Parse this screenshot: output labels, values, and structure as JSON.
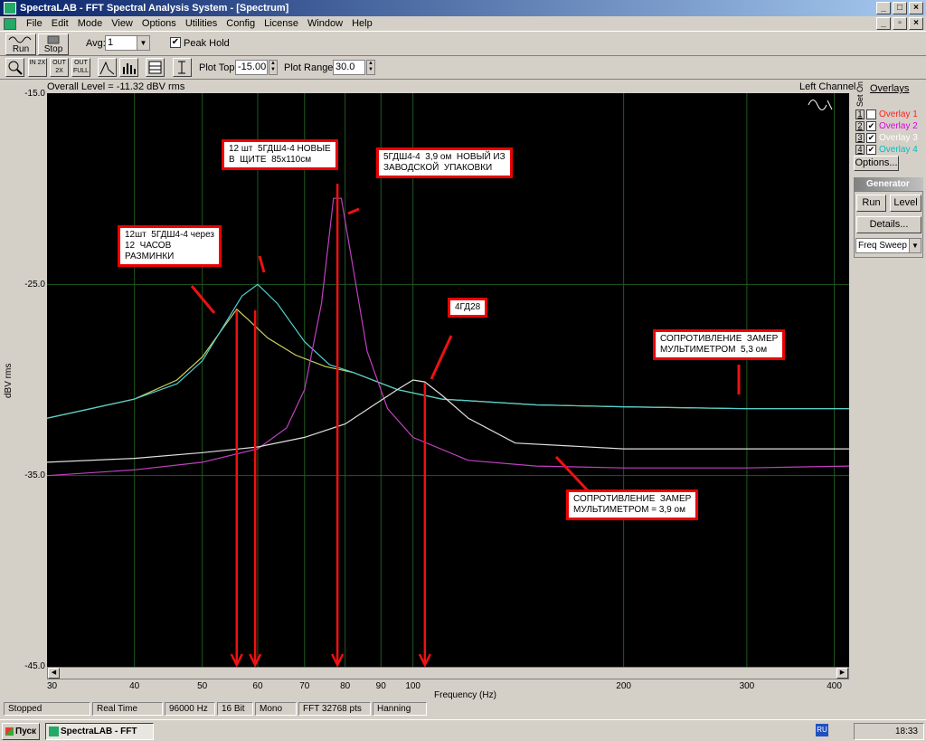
{
  "window": {
    "title": "SpectraLAB - FFT Spectral Analysis System - [Spectrum]"
  },
  "menu": [
    "File",
    "Edit",
    "Mode",
    "View",
    "Options",
    "Utilities",
    "Config",
    "License",
    "Window",
    "Help"
  ],
  "toolbar": {
    "run_label": "Run",
    "stop_label": "Stop",
    "avg_label": "Avg:",
    "avg_value": "1",
    "peak_hold_label": "Peak Hold",
    "peak_hold_checked": true,
    "plot_top_label": "Plot Top:",
    "plot_top_value": "-15.00",
    "plot_range_label": "Plot Range:",
    "plot_range_value": "30.0",
    "small_buttons": [
      "IN 2X",
      "OUT 2X",
      "OUT FULL"
    ]
  },
  "plot": {
    "overall_level": "Overall Level = -11.32 dBV rms",
    "channel": "Left Channel"
  },
  "chart_data": {
    "type": "line",
    "xlabel": "Frequency (Hz)",
    "ylabel": "dBV rms",
    "xscale": "log",
    "xlim": [
      30,
      420
    ],
    "ylim": [
      -45,
      -15
    ],
    "x_ticks": [
      "30",
      "40",
      "50",
      "60",
      "70",
      "80",
      "90",
      "100",
      "200",
      "300",
      "400"
    ],
    "y_ticks": [
      "-15.0",
      "-25.0",
      "-35.0",
      "-45.0"
    ],
    "grid": true,
    "series": [
      {
        "color": "#d0d060",
        "x": [
          30,
          40,
          46,
          50,
          53,
          56,
          58,
          62,
          68,
          75,
          82,
          95,
          110,
          150,
          200,
          300,
          420
        ],
        "y": [
          -32.0,
          -31.0,
          -30.0,
          -28.8,
          -27.5,
          -26.3,
          -26.8,
          -27.8,
          -28.7,
          -29.3,
          -29.6,
          -30.5,
          -31.0,
          -31.3,
          -31.4,
          -31.5,
          -31.5
        ]
      },
      {
        "color": "#50d0d0",
        "x": [
          30,
          40,
          46,
          50,
          54,
          57,
          60,
          64,
          70,
          76,
          82,
          95,
          110,
          150,
          200,
          300,
          420
        ],
        "y": [
          -32.0,
          -31.0,
          -30.2,
          -29.0,
          -27.0,
          -25.6,
          -25.0,
          -26.0,
          -28.0,
          -29.2,
          -29.6,
          -30.5,
          -31.0,
          -31.3,
          -31.4,
          -31.5,
          -31.5
        ]
      },
      {
        "color": "#c040c0",
        "x": [
          30,
          40,
          50,
          60,
          66,
          70,
          74,
          77,
          79,
          82,
          86,
          92,
          100,
          120,
          150,
          200,
          300,
          420
        ],
        "y": [
          -35.0,
          -34.7,
          -34.3,
          -33.6,
          -32.5,
          -30.5,
          -26.0,
          -20.5,
          -20.5,
          -24.0,
          -28.5,
          -31.5,
          -33.0,
          -34.2,
          -34.5,
          -34.6,
          -34.6,
          -34.5
        ]
      },
      {
        "color": "#e0e0e0",
        "x": [
          30,
          40,
          50,
          60,
          70,
          80,
          88,
          95,
          100,
          104,
          110,
          120,
          140,
          200,
          300,
          420
        ],
        "y": [
          -34.3,
          -34.1,
          -33.8,
          -33.5,
          -33.0,
          -32.3,
          -31.3,
          -30.5,
          -30.0,
          -30.1,
          -30.8,
          -32.0,
          -33.3,
          -33.6,
          -33.6,
          -33.6
        ]
      }
    ],
    "annotations": [
      "12шт  5ГДШ4-4 через\n12  ЧАСОВ\nРАЗМИНКИ",
      "12 шт  5ГДШ4-4 НОВЫЕ\nВ  ЩИТЕ  85х110см",
      "5ГДШ4-4  3,9 ом  НОВЫЙ ИЗ\nЗАВОДСКОЙ  УПАКОВКИ",
      "4ГД28",
      "СОПРОТИВЛЕНИЕ  ЗАМЕР\nМУЛЬТИМЕТРОМ  5,3 ом",
      "СОПРОТИВЛЕНИЕ  ЗАМЕР\nМУЛЬТИМЕТРОМ = 3,9 ом"
    ]
  },
  "overlays": {
    "title": "Overlays",
    "set_on": "Set On",
    "items": [
      {
        "num": "1",
        "name": "Overlay 1",
        "checked": false,
        "color": "#ff2020"
      },
      {
        "num": "2",
        "name": "Overlay 2",
        "checked": true,
        "color": "#e000e0"
      },
      {
        "num": "3",
        "name": "Overlay 3",
        "checked": true,
        "color": "#ffffff"
      },
      {
        "num": "4",
        "name": "Overlay 4",
        "checked": true,
        "color": "#00c0c0"
      }
    ],
    "options_label": "Options..."
  },
  "generator": {
    "title": "Generator",
    "run_label": "Run",
    "level_label": "Level",
    "details_label": "Details...",
    "mode": "Freq Sweep"
  },
  "status": [
    "Stopped",
    "Real Time",
    "96000 Hz",
    "16 Bit",
    "Mono",
    "FFT 32768 pts",
    "Hanning"
  ],
  "taskbar": {
    "start_label": "Пуск",
    "task_label": "SpectraLAB - FFT Spe...",
    "lang": "RU",
    "clock": "18:33"
  }
}
